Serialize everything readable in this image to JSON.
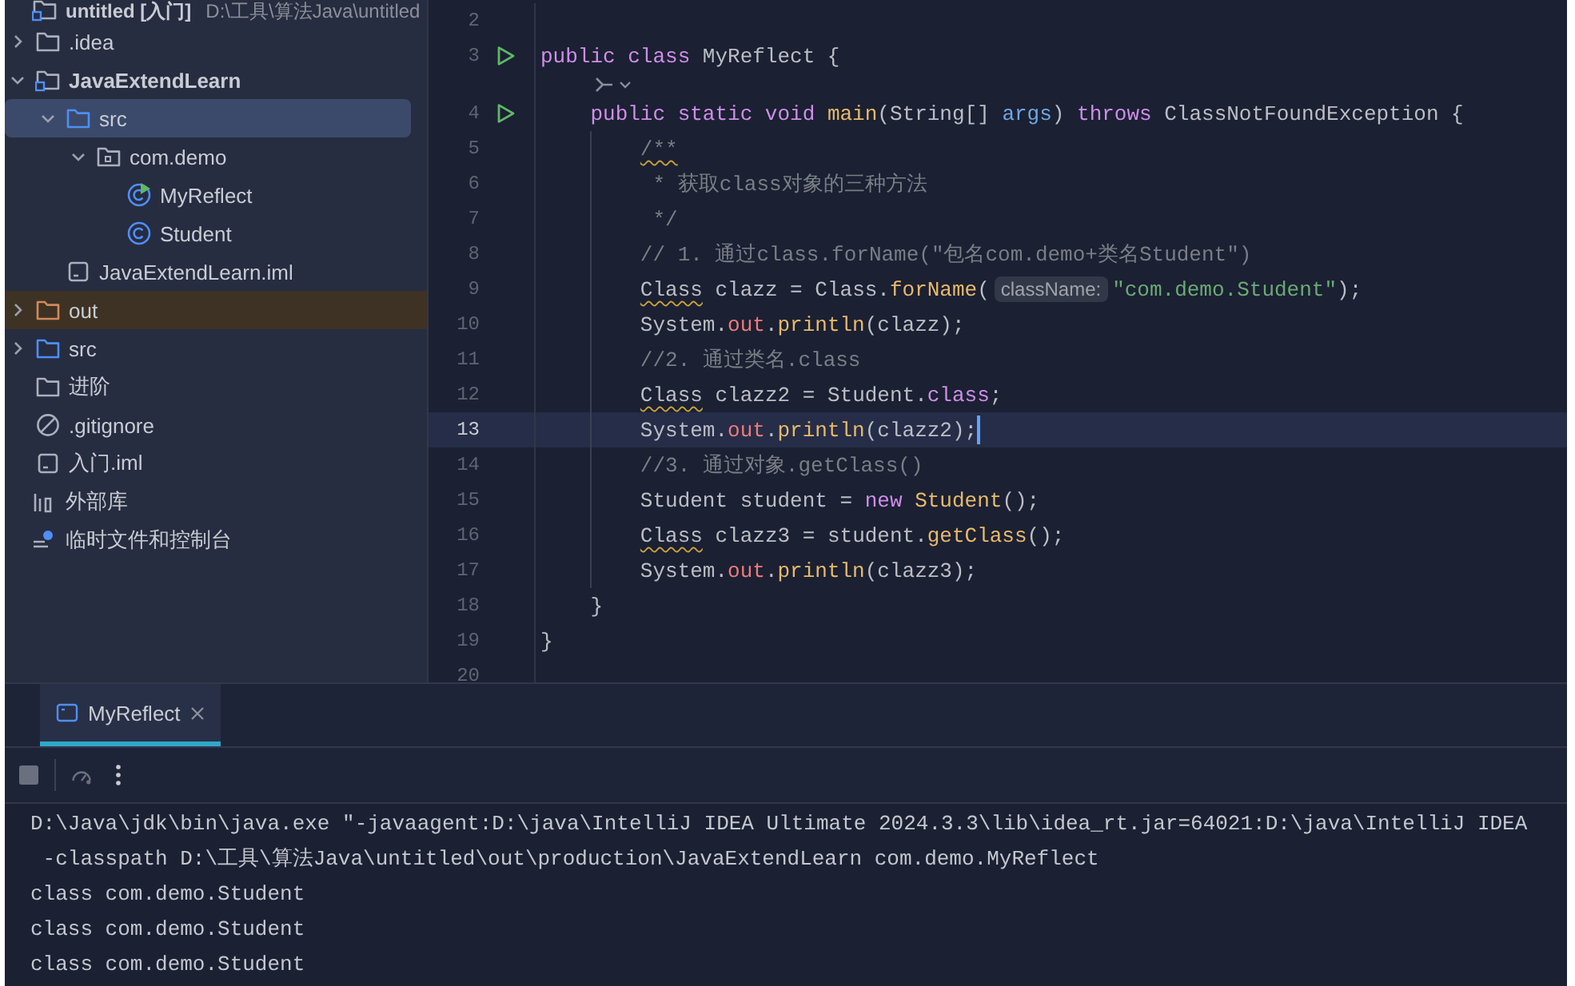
{
  "project_tree": {
    "items": [
      {
        "label": "untitled [入门]",
        "path": "D:\\工具\\算法Java\\untitled",
        "kind": "root",
        "selected": false,
        "children": [
          {
            "label": ".idea",
            "kind": "folder",
            "expanded": false,
            "selected": false
          },
          {
            "label": "JavaExtendLearn",
            "kind": "module",
            "bold": true,
            "expanded": true,
            "selected": false,
            "children": [
              {
                "label": "src",
                "kind": "source",
                "expanded": true,
                "selected": true,
                "children": [
                  {
                    "label": "com.demo",
                    "kind": "package",
                    "expanded": true,
                    "selected": false,
                    "children": [
                      {
                        "label": "MyReflect",
                        "kind": "class-run",
                        "selected": false
                      },
                      {
                        "label": "Student",
                        "kind": "class",
                        "selected": false
                      }
                    ]
                  }
                ]
              },
              {
                "label": "JavaExtendLearn.iml",
                "kind": "file",
                "selected": false
              }
            ]
          },
          {
            "label": "out",
            "kind": "excluded",
            "expanded": false,
            "selected": false
          },
          {
            "label": "src",
            "kind": "source",
            "expanded": false,
            "selected": false
          },
          {
            "label": "进阶",
            "kind": "folder",
            "selected": false
          },
          {
            "label": ".gitignore",
            "kind": "ignore",
            "selected": false
          },
          {
            "label": "入门.iml",
            "kind": "file",
            "selected": false
          }
        ]
      },
      {
        "label": "外部库",
        "kind": "library",
        "selected": false
      },
      {
        "label": "临时文件和控制台",
        "kind": "scratch",
        "selected": false
      }
    ]
  },
  "editor": {
    "lines": [
      {
        "kind": "code",
        "number": "2"
      },
      {
        "kind": "code",
        "number": "3",
        "run": true,
        "tokens": [
          {
            "kind": "keyword",
            "text": "public class "
          },
          {
            "kind": "plain",
            "text": "MyReflect {"
          }
        ]
      },
      {
        "kind": "inlay"
      },
      {
        "kind": "code",
        "number": "4",
        "run": true,
        "tokens": [
          {
            "kind": "keyword",
            "text": "    public static void "
          },
          {
            "kind": "method",
            "text": "main"
          },
          {
            "kind": "plain",
            "text": "(String[] "
          },
          {
            "kind": "param",
            "text": "args"
          },
          {
            "kind": "plain",
            "text": ") "
          },
          {
            "kind": "keyword",
            "text": "throws "
          },
          {
            "kind": "plain",
            "text": "ClassNotFoundException {"
          }
        ]
      },
      {
        "kind": "code",
        "number": "5",
        "guide": true,
        "tokens": [
          {
            "kind": "comment",
            "text": "        /**",
            "warning": true
          }
        ]
      },
      {
        "kind": "code",
        "number": "6",
        "guide": true,
        "tokens": [
          {
            "kind": "comment",
            "text": "         * 获取class对象的三种方法"
          }
        ]
      },
      {
        "kind": "code",
        "number": "7",
        "guide": true,
        "tokens": [
          {
            "kind": "comment",
            "text": "         */"
          }
        ]
      },
      {
        "kind": "code",
        "number": "8",
        "guide": true,
        "tokens": [
          {
            "kind": "comment",
            "text": "        // 1. 通过class.forName(\"包名com.demo+类名Student\")"
          }
        ]
      },
      {
        "kind": "code",
        "number": "9",
        "guide": true,
        "tokens": [
          {
            "kind": "plain",
            "text": "        Class",
            "warning": true
          },
          {
            "kind": "plain",
            "text": " clazz = Class."
          },
          {
            "kind": "method",
            "text": "forName"
          },
          {
            "kind": "plain",
            "text": "("
          },
          {
            "kind": "hint",
            "text": "className:"
          },
          {
            "kind": "string",
            "text": "\"com.demo.Student\""
          },
          {
            "kind": "plain",
            "text": ");"
          }
        ]
      },
      {
        "kind": "code",
        "number": "10",
        "guide": true,
        "tokens": [
          {
            "kind": "plain",
            "text": "        System."
          },
          {
            "kind": "field",
            "text": "out"
          },
          {
            "kind": "plain",
            "text": "."
          },
          {
            "kind": "method",
            "text": "println"
          },
          {
            "kind": "plain",
            "text": "(clazz);"
          }
        ]
      },
      {
        "kind": "code",
        "number": "11",
        "guide": true,
        "tokens": [
          {
            "kind": "comment",
            "text": "        //2. 通过类名.class"
          }
        ]
      },
      {
        "kind": "code",
        "number": "12",
        "guide": true,
        "tokens": [
          {
            "kind": "plain",
            "text": "        Class",
            "warning": true
          },
          {
            "kind": "plain",
            "text": " clazz2 = Student."
          },
          {
            "kind": "keyword",
            "text": "class"
          },
          {
            "kind": "plain",
            "text": ";"
          }
        ]
      },
      {
        "kind": "code",
        "number": "13",
        "guide": true,
        "current": true,
        "tokens": [
          {
            "kind": "plain",
            "text": "        System."
          },
          {
            "kind": "field",
            "text": "out"
          },
          {
            "kind": "plain",
            "text": "."
          },
          {
            "kind": "method",
            "text": "println"
          },
          {
            "kind": "plain",
            "text": "(clazz2);"
          }
        ]
      },
      {
        "kind": "code",
        "number": "14",
        "guide": true,
        "tokens": [
          {
            "kind": "comment",
            "text": "        //3. 通过对象.getClass()"
          }
        ]
      },
      {
        "kind": "code",
        "number": "15",
        "guide": true,
        "tokens": [
          {
            "kind": "plain",
            "text": "        Student student = "
          },
          {
            "kind": "keyword",
            "text": "new "
          },
          {
            "kind": "method",
            "text": "Student"
          },
          {
            "kind": "plain",
            "text": "();"
          }
        ]
      },
      {
        "kind": "code",
        "number": "16",
        "guide": true,
        "tokens": [
          {
            "kind": "plain",
            "text": "        Class",
            "warning": true
          },
          {
            "kind": "plain",
            "text": " clazz3 = student."
          },
          {
            "kind": "method",
            "text": "getClass"
          },
          {
            "kind": "plain",
            "text": "();"
          }
        ]
      },
      {
        "kind": "code",
        "number": "17",
        "guide": true,
        "tokens": [
          {
            "kind": "plain",
            "text": "        System."
          },
          {
            "kind": "field",
            "text": "out"
          },
          {
            "kind": "plain",
            "text": "."
          },
          {
            "kind": "method",
            "text": "println"
          },
          {
            "kind": "plain",
            "text": "(clazz3);"
          }
        ]
      },
      {
        "kind": "code",
        "number": "18",
        "tokens": [
          {
            "kind": "plain",
            "text": "    }"
          }
        ]
      },
      {
        "kind": "code",
        "number": "19",
        "tokens": [
          {
            "kind": "plain",
            "text": "}"
          }
        ]
      },
      {
        "kind": "code",
        "number": "20"
      }
    ]
  },
  "run_panel": {
    "tabs": [
      {
        "label": "MyReflect",
        "selected": true
      }
    ],
    "console": [
      "D:\\Java\\jdk\\bin\\java.exe \"-javaagent:D:\\java\\IntelliJ IDEA Ultimate 2024.3.3\\lib\\idea_rt.jar=64021:D:\\java\\IntelliJ IDEA",
      " -classpath D:\\工具\\算法Java\\untitled\\out\\production\\JavaExtendLearn com.demo.MyReflect",
      "class com.demo.Student",
      "class com.demo.Student",
      "class com.demo.Student"
    ]
  }
}
